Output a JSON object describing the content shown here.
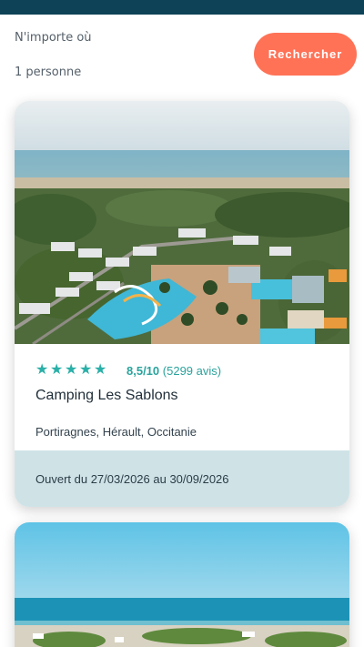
{
  "search": {
    "destination": "N'importe où",
    "guests": "1 personne",
    "button_label": "Rechercher"
  },
  "colors": {
    "header": "#0e4257",
    "accent": "#ff7256",
    "rating": "#2ab0a8",
    "dates_bg": "#cfe3e7"
  },
  "results": [
    {
      "stars": 5,
      "rating_score": "8,5/10",
      "rating_count": "(5299 avis)",
      "name": "Camping Les Sablons",
      "location": "Portiragnes, Hérault, Occitanie",
      "dates": "Ouvert du 27/03/2026 au 30/09/2026"
    }
  ]
}
